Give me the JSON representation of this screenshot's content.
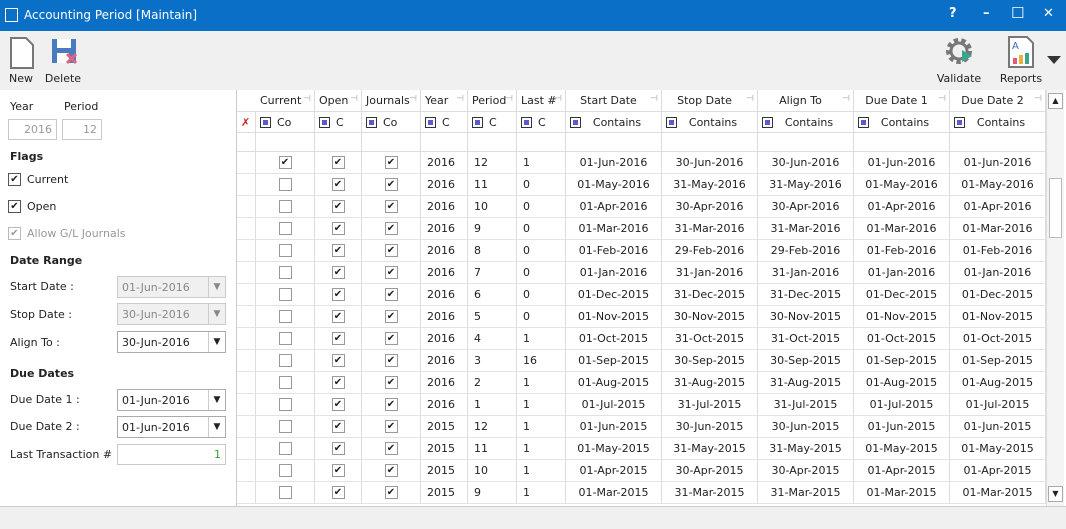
{
  "window": {
    "title": "Accounting Period [Maintain]",
    "help": "?",
    "minimize": "–",
    "maximize": "☐",
    "close": "✕"
  },
  "toolbar": {
    "new": "New",
    "delete": "Delete",
    "validate": "Validate",
    "reports": "Reports"
  },
  "form": {
    "year_label": "Year",
    "year_value": "2016",
    "period_label": "Period",
    "period_value": "12",
    "flags_label": "Flags",
    "current_label": "Current",
    "current_checked": true,
    "open_label": "Open",
    "open_checked": true,
    "allow_gl_label": "Allow G/L Journals",
    "allow_gl_checked": true,
    "date_range_label": "Date Range",
    "start_label": "Start Date :",
    "start_value": "01-Jun-2016",
    "stop_label": "Stop Date :",
    "stop_value": "30-Jun-2016",
    "align_label": "Align To :",
    "align_value": "30-Jun-2016",
    "due_dates_label": "Due Dates",
    "due1_label": "Due Date 1 :",
    "due1_value": "01-Jun-2016",
    "due2_label": "Due Date 2 :",
    "due2_value": "01-Jun-2016",
    "last_tx_label": "Last Transaction #",
    "last_tx_value": "1"
  },
  "grid": {
    "columns": [
      "Current",
      "Open",
      "Journals",
      "Year",
      "Period",
      "Last #",
      "Start Date",
      "Stop Date",
      "Align To",
      "Due Date 1",
      "Due Date 2"
    ],
    "filters": [
      "Co",
      "C",
      "Co",
      "C",
      "C",
      "C",
      "Contains",
      "Contains",
      "Contains",
      "Contains",
      "Contains"
    ],
    "rows": [
      [
        true,
        true,
        true,
        "2016",
        "12",
        "1",
        "01-Jun-2016",
        "30-Jun-2016",
        "30-Jun-2016",
        "01-Jun-2016",
        "01-Jun-2016"
      ],
      [
        false,
        true,
        true,
        "2016",
        "11",
        "0",
        "01-May-2016",
        "31-May-2016",
        "31-May-2016",
        "01-May-2016",
        "01-May-2016"
      ],
      [
        false,
        true,
        true,
        "2016",
        "10",
        "0",
        "01-Apr-2016",
        "30-Apr-2016",
        "30-Apr-2016",
        "01-Apr-2016",
        "01-Apr-2016"
      ],
      [
        false,
        true,
        true,
        "2016",
        "9",
        "0",
        "01-Mar-2016",
        "31-Mar-2016",
        "31-Mar-2016",
        "01-Mar-2016",
        "01-Mar-2016"
      ],
      [
        false,
        true,
        true,
        "2016",
        "8",
        "0",
        "01-Feb-2016",
        "29-Feb-2016",
        "29-Feb-2016",
        "01-Feb-2016",
        "01-Feb-2016"
      ],
      [
        false,
        true,
        true,
        "2016",
        "7",
        "0",
        "01-Jan-2016",
        "31-Jan-2016",
        "31-Jan-2016",
        "01-Jan-2016",
        "01-Jan-2016"
      ],
      [
        false,
        true,
        true,
        "2016",
        "6",
        "0",
        "01-Dec-2015",
        "31-Dec-2015",
        "31-Dec-2015",
        "01-Dec-2015",
        "01-Dec-2015"
      ],
      [
        false,
        true,
        true,
        "2016",
        "5",
        "0",
        "01-Nov-2015",
        "30-Nov-2015",
        "30-Nov-2015",
        "01-Nov-2015",
        "01-Nov-2015"
      ],
      [
        false,
        true,
        true,
        "2016",
        "4",
        "1",
        "01-Oct-2015",
        "31-Oct-2015",
        "31-Oct-2015",
        "01-Oct-2015",
        "01-Oct-2015"
      ],
      [
        false,
        true,
        true,
        "2016",
        "3",
        "16",
        "01-Sep-2015",
        "30-Sep-2015",
        "30-Sep-2015",
        "01-Sep-2015",
        "01-Sep-2015"
      ],
      [
        false,
        true,
        true,
        "2016",
        "2",
        "1",
        "01-Aug-2015",
        "31-Aug-2015",
        "31-Aug-2015",
        "01-Aug-2015",
        "01-Aug-2015"
      ],
      [
        false,
        true,
        true,
        "2016",
        "1",
        "1",
        "01-Jul-2015",
        "31-Jul-2015",
        "31-Jul-2015",
        "01-Jul-2015",
        "01-Jul-2015"
      ],
      [
        false,
        true,
        true,
        "2015",
        "12",
        "1",
        "01-Jun-2015",
        "30-Jun-2015",
        "30-Jun-2015",
        "01-Jun-2015",
        "01-Jun-2015"
      ],
      [
        false,
        true,
        true,
        "2015",
        "11",
        "1",
        "01-May-2015",
        "31-May-2015",
        "31-May-2015",
        "01-May-2015",
        "01-May-2015"
      ],
      [
        false,
        true,
        true,
        "2015",
        "10",
        "1",
        "01-Apr-2015",
        "30-Apr-2015",
        "30-Apr-2015",
        "01-Apr-2015",
        "01-Apr-2015"
      ],
      [
        false,
        true,
        true,
        "2015",
        "9",
        "1",
        "01-Mar-2015",
        "31-Mar-2015",
        "31-Mar-2015",
        "01-Mar-2015",
        "01-Mar-2015"
      ]
    ]
  }
}
